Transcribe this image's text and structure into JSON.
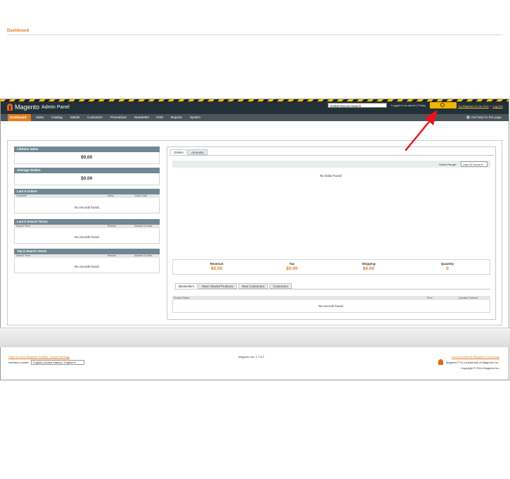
{
  "header": {
    "logo_text": "Magento",
    "logo_sub": "Admin Panel",
    "search_value": "Global Record Search",
    "logged_in": "Logged in as admin  |  Friday",
    "links": [
      "Try Magento Go for Free",
      "Log Out"
    ]
  },
  "nav": {
    "items": [
      "Dashboard",
      "Sales",
      "Catalog",
      "Mobile",
      "Customers",
      "Promotions",
      "Newsletter",
      "CMS",
      "Reports",
      "System"
    ],
    "help": "Get help for this page"
  },
  "page_title": "Dashboard",
  "lifetime_sales": {
    "title": "Lifetime Sales",
    "value": "$0.00"
  },
  "average_orders": {
    "title": "Average Orders",
    "value": "$0.00"
  },
  "last_orders": {
    "title": "Last 5 Orders",
    "columns": [
      "Customer",
      "Items",
      "Grand Total"
    ],
    "empty": "No records found."
  },
  "last_search": {
    "title": "Last 5 Search Terms",
    "columns": [
      "Search Term",
      "Results",
      "Number of Uses"
    ],
    "empty": "No records found."
  },
  "top_search": {
    "title": "Top 5 Search Terms",
    "columns": [
      "Search Term",
      "Results",
      "Number of Uses"
    ],
    "empty": "No records found."
  },
  "chart_tabs": [
    "Orders",
    "Amounts"
  ],
  "range": {
    "label": "Select Range:",
    "value": "Last 24 Hours"
  },
  "no_data": "No Data Found",
  "totals": [
    {
      "label": "Revenue",
      "value": "$0.00"
    },
    {
      "label": "Tax",
      "value": "$0.00"
    },
    {
      "label": "Shipping",
      "value": "$0.00"
    },
    {
      "label": "Quantity",
      "value": "0"
    }
  ],
  "grid_tabs": [
    "Bestsellers",
    "Most Viewed Products",
    "New Customers",
    "Customers"
  ],
  "bestsellers": {
    "columns": [
      "Product Name",
      "Price",
      "Quantity Ordered"
    ],
    "empty": "No records found."
  },
  "footer": {
    "help_link": "Help Us Keep Magento Healthy - Report All Bugs",
    "locale_label": "Interface Locale:",
    "locale_value": "English (United States) / English",
    "version": "Magento ver. 1.7.0.2",
    "connect": "Connect with the Magento Community",
    "trademark": "Magento™ is a trademark of Magento Inc.",
    "copyright": "Copyright © 2014 Magento Inc."
  },
  "colors": {
    "accent": "#e47b20",
    "header": "#223038",
    "nav": "#4b565c",
    "widget_head": "#6f8992",
    "annotation": "#e8151b"
  }
}
